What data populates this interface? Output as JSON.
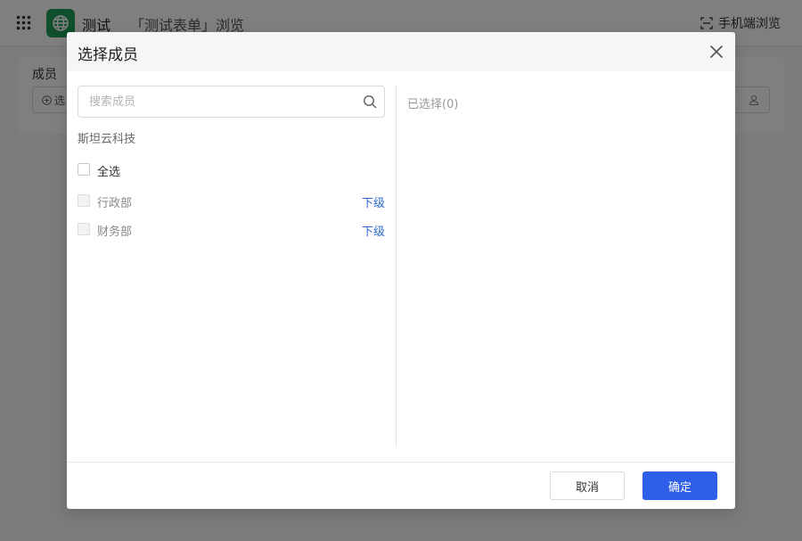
{
  "app": {
    "name": "测试",
    "form_title": "「测试表单」浏览",
    "mobile_view_label": "手机端浏览",
    "brand_color": "#1e9e58"
  },
  "form": {
    "field_label": "成员",
    "select_button_label": "选"
  },
  "modal": {
    "title": "选择成员",
    "search_placeholder": "搜索成员",
    "org_name": "斯坦云科技",
    "select_all_label": "全选",
    "departments": [
      {
        "name": "行政部",
        "sub_label": "下级"
      },
      {
        "name": "财务部",
        "sub_label": "下级"
      }
    ],
    "selected_label": "已选择(0)",
    "cancel_label": "取消",
    "confirm_label": "确定",
    "accent_color": "#2f5fe8",
    "link_color": "#2f6ad0"
  }
}
